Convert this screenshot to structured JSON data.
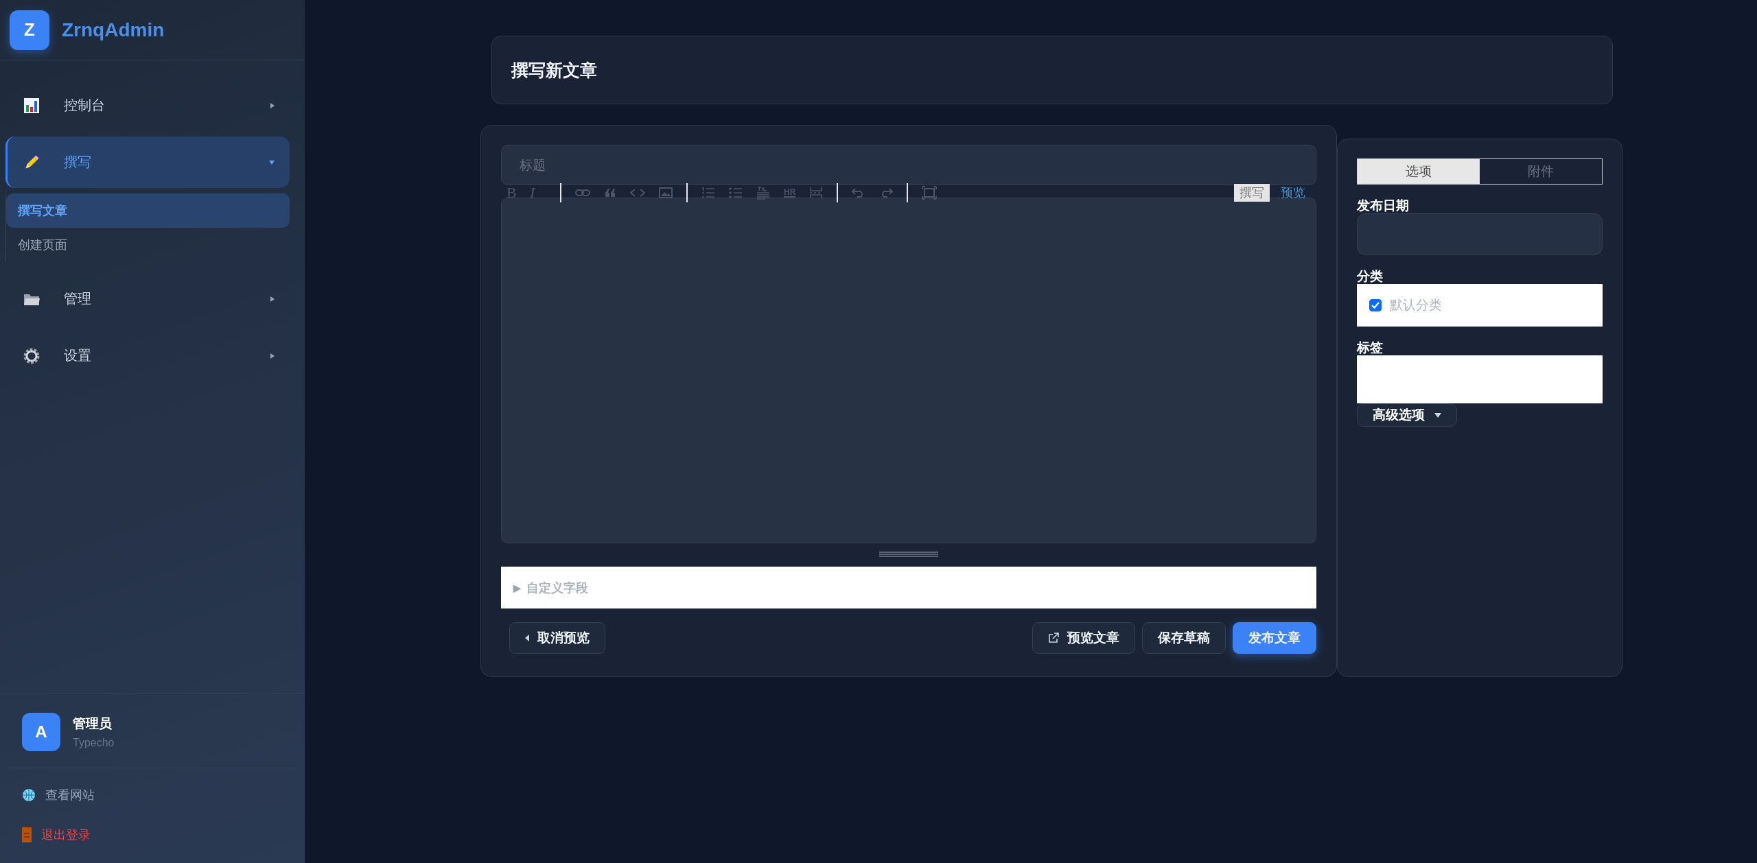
{
  "brand": {
    "logo_letter": "Z",
    "name": "ZrnqAdmin"
  },
  "nav": [
    {
      "label": "控制台",
      "selected": false,
      "expanded": false
    },
    {
      "label": "撰写",
      "selected": true,
      "expanded": true,
      "children": [
        {
          "label": "撰写文章",
          "selected": true
        },
        {
          "label": "创建页面",
          "selected": false
        }
      ]
    },
    {
      "label": "管理",
      "selected": false,
      "expanded": false
    },
    {
      "label": "设置",
      "selected": false,
      "expanded": false
    }
  ],
  "user": {
    "avatar_letter": "A",
    "name": "管理员",
    "role": "Typecho"
  },
  "links": [
    {
      "label": "查看网站",
      "kind": "site"
    },
    {
      "label": "退出登录",
      "kind": "logout"
    }
  ],
  "page_title": "撰写新文章",
  "editor": {
    "title_placeholder": "标题",
    "toolbar": {
      "bold": "B",
      "italic": "I",
      "hr": "HR"
    },
    "modes": [
      {
        "label": "撰写",
        "selected": true
      },
      {
        "label": "预览",
        "selected": false
      }
    ],
    "custom_fields": {
      "marker": "▶",
      "label": "自定义字段",
      "expanded": false
    }
  },
  "buttons": [
    {
      "label": "取消预览",
      "kind": "back"
    },
    {
      "label": "预览文章",
      "kind": "external"
    },
    {
      "label": "保存草稿",
      "kind": "plain"
    },
    {
      "label": "发布文章",
      "kind": "primary"
    }
  ],
  "panel": {
    "tabs": [
      {
        "label": "选项",
        "selected": true
      },
      {
        "label": "附件",
        "selected": false
      }
    ],
    "date_label": "发布日期",
    "category_label": "分类",
    "categories": [
      {
        "label": "默认分类",
        "checked": true
      }
    ],
    "tags_label": "标签",
    "advanced": "高级选项"
  }
}
